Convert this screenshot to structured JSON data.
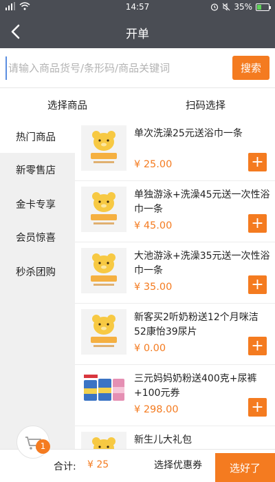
{
  "status_bar": {
    "time": "14:57",
    "battery_percent": "35%",
    "battery_level": 0.35,
    "icons": [
      "signal-icon",
      "wifi-icon",
      "alarm-icon",
      "mute-icon",
      "battery-icon"
    ]
  },
  "header": {
    "title": "开单",
    "back_icon": "chevron-left-icon"
  },
  "search": {
    "placeholder": "请输入商品货号/条形码/商品关键词",
    "value": "",
    "button_label": "搜索"
  },
  "tabs": [
    {
      "label": "选择商品"
    },
    {
      "label": "扫码选择"
    }
  ],
  "categories": [
    {
      "label": "热门商品",
      "active": true
    },
    {
      "label": "新零售店",
      "active": false
    },
    {
      "label": "金卡专享",
      "active": false
    },
    {
      "label": "会员惊喜",
      "active": false
    },
    {
      "label": "秒杀团购",
      "active": false
    }
  ],
  "products": [
    {
      "name": "单次洗澡25元送浴巾一条",
      "price": "¥ 25.00",
      "add_label": "+"
    },
    {
      "name": "单独游泳+洗澡45元送一次性浴巾一条",
      "price": "¥ 45.00",
      "add_label": "+"
    },
    {
      "name": "大池游泳+洗澡35元送一次性浴巾一条",
      "price": "¥ 35.00",
      "add_label": "+"
    },
    {
      "name": "新客买2听奶粉送12个月咪洁52康怡39尿片",
      "price": "¥ 0.00",
      "add_label": "+"
    },
    {
      "name": "三元妈妈奶粉送400克+尿裤+100元券",
      "price": "¥ 298.00",
      "add_label": "+"
    },
    {
      "name": "新生儿大礼包",
      "price": "",
      "add_label": "+"
    }
  ],
  "bottom": {
    "cart_count": "1",
    "total_label": "合计:",
    "total_value": "¥ 25",
    "coupon_label": "选择优惠券",
    "confirm_label": "选好了"
  },
  "colors": {
    "accent": "#f47b20",
    "header_bg": "#4a4d54",
    "category_bg": "#f0f0f0"
  }
}
